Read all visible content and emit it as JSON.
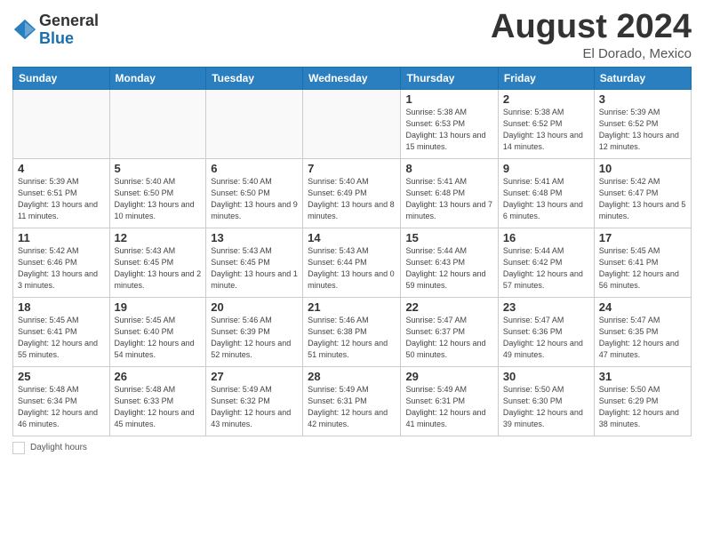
{
  "header": {
    "logo_general": "General",
    "logo_blue": "Blue",
    "month_title": "August 2024",
    "location": "El Dorado, Mexico"
  },
  "footer": {
    "daylight_label": "Daylight hours"
  },
  "days_of_week": [
    "Sunday",
    "Monday",
    "Tuesday",
    "Wednesday",
    "Thursday",
    "Friday",
    "Saturday"
  ],
  "weeks": [
    [
      {
        "day": "",
        "info": ""
      },
      {
        "day": "",
        "info": ""
      },
      {
        "day": "",
        "info": ""
      },
      {
        "day": "",
        "info": ""
      },
      {
        "day": "1",
        "info": "Sunrise: 5:38 AM\nSunset: 6:53 PM\nDaylight: 13 hours\nand 15 minutes."
      },
      {
        "day": "2",
        "info": "Sunrise: 5:38 AM\nSunset: 6:52 PM\nDaylight: 13 hours\nand 14 minutes."
      },
      {
        "day": "3",
        "info": "Sunrise: 5:39 AM\nSunset: 6:52 PM\nDaylight: 13 hours\nand 12 minutes."
      }
    ],
    [
      {
        "day": "4",
        "info": "Sunrise: 5:39 AM\nSunset: 6:51 PM\nDaylight: 13 hours\nand 11 minutes."
      },
      {
        "day": "5",
        "info": "Sunrise: 5:40 AM\nSunset: 6:50 PM\nDaylight: 13 hours\nand 10 minutes."
      },
      {
        "day": "6",
        "info": "Sunrise: 5:40 AM\nSunset: 6:50 PM\nDaylight: 13 hours\nand 9 minutes."
      },
      {
        "day": "7",
        "info": "Sunrise: 5:40 AM\nSunset: 6:49 PM\nDaylight: 13 hours\nand 8 minutes."
      },
      {
        "day": "8",
        "info": "Sunrise: 5:41 AM\nSunset: 6:48 PM\nDaylight: 13 hours\nand 7 minutes."
      },
      {
        "day": "9",
        "info": "Sunrise: 5:41 AM\nSunset: 6:48 PM\nDaylight: 13 hours\nand 6 minutes."
      },
      {
        "day": "10",
        "info": "Sunrise: 5:42 AM\nSunset: 6:47 PM\nDaylight: 13 hours\nand 5 minutes."
      }
    ],
    [
      {
        "day": "11",
        "info": "Sunrise: 5:42 AM\nSunset: 6:46 PM\nDaylight: 13 hours\nand 3 minutes."
      },
      {
        "day": "12",
        "info": "Sunrise: 5:43 AM\nSunset: 6:45 PM\nDaylight: 13 hours\nand 2 minutes."
      },
      {
        "day": "13",
        "info": "Sunrise: 5:43 AM\nSunset: 6:45 PM\nDaylight: 13 hours\nand 1 minute."
      },
      {
        "day": "14",
        "info": "Sunrise: 5:43 AM\nSunset: 6:44 PM\nDaylight: 13 hours\nand 0 minutes."
      },
      {
        "day": "15",
        "info": "Sunrise: 5:44 AM\nSunset: 6:43 PM\nDaylight: 12 hours\nand 59 minutes."
      },
      {
        "day": "16",
        "info": "Sunrise: 5:44 AM\nSunset: 6:42 PM\nDaylight: 12 hours\nand 57 minutes."
      },
      {
        "day": "17",
        "info": "Sunrise: 5:45 AM\nSunset: 6:41 PM\nDaylight: 12 hours\nand 56 minutes."
      }
    ],
    [
      {
        "day": "18",
        "info": "Sunrise: 5:45 AM\nSunset: 6:41 PM\nDaylight: 12 hours\nand 55 minutes."
      },
      {
        "day": "19",
        "info": "Sunrise: 5:45 AM\nSunset: 6:40 PM\nDaylight: 12 hours\nand 54 minutes."
      },
      {
        "day": "20",
        "info": "Sunrise: 5:46 AM\nSunset: 6:39 PM\nDaylight: 12 hours\nand 52 minutes."
      },
      {
        "day": "21",
        "info": "Sunrise: 5:46 AM\nSunset: 6:38 PM\nDaylight: 12 hours\nand 51 minutes."
      },
      {
        "day": "22",
        "info": "Sunrise: 5:47 AM\nSunset: 6:37 PM\nDaylight: 12 hours\nand 50 minutes."
      },
      {
        "day": "23",
        "info": "Sunrise: 5:47 AM\nSunset: 6:36 PM\nDaylight: 12 hours\nand 49 minutes."
      },
      {
        "day": "24",
        "info": "Sunrise: 5:47 AM\nSunset: 6:35 PM\nDaylight: 12 hours\nand 47 minutes."
      }
    ],
    [
      {
        "day": "25",
        "info": "Sunrise: 5:48 AM\nSunset: 6:34 PM\nDaylight: 12 hours\nand 46 minutes."
      },
      {
        "day": "26",
        "info": "Sunrise: 5:48 AM\nSunset: 6:33 PM\nDaylight: 12 hours\nand 45 minutes."
      },
      {
        "day": "27",
        "info": "Sunrise: 5:49 AM\nSunset: 6:32 PM\nDaylight: 12 hours\nand 43 minutes."
      },
      {
        "day": "28",
        "info": "Sunrise: 5:49 AM\nSunset: 6:31 PM\nDaylight: 12 hours\nand 42 minutes."
      },
      {
        "day": "29",
        "info": "Sunrise: 5:49 AM\nSunset: 6:31 PM\nDaylight: 12 hours\nand 41 minutes."
      },
      {
        "day": "30",
        "info": "Sunrise: 5:50 AM\nSunset: 6:30 PM\nDaylight: 12 hours\nand 39 minutes."
      },
      {
        "day": "31",
        "info": "Sunrise: 5:50 AM\nSunset: 6:29 PM\nDaylight: 12 hours\nand 38 minutes."
      }
    ]
  ]
}
